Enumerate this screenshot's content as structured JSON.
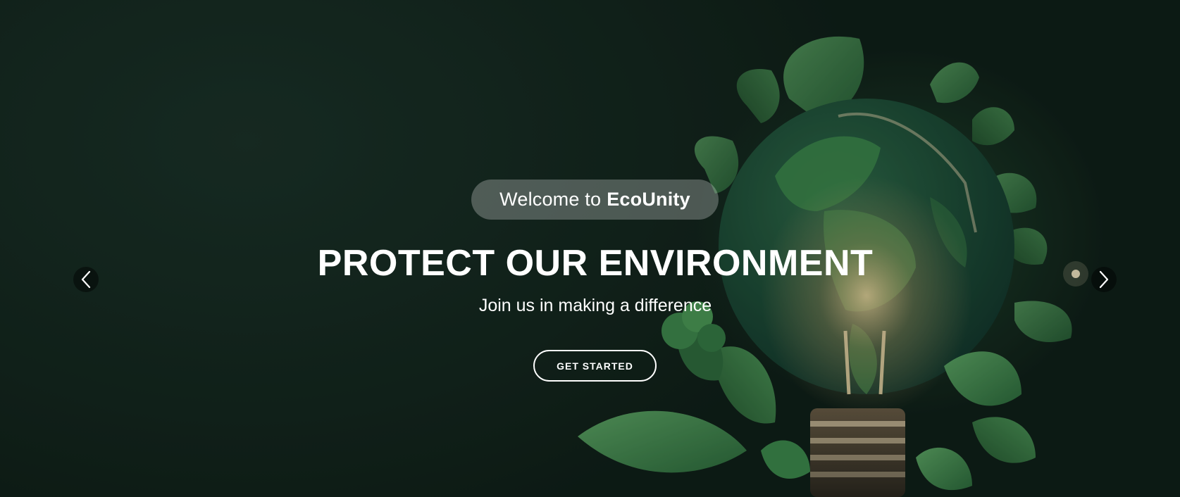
{
  "hero": {
    "welcome_prefix": "Welcome to",
    "brand_name": "EcoUnity",
    "headline": "PROTECT OUR ENVIRONMENT",
    "subheadline": "Join us in making a difference",
    "cta_label": "GET STARTED"
  },
  "icons": {
    "prev": "chevron-left-icon",
    "next": "chevron-right-icon",
    "background": "globe-lightbulb-leaves-image"
  },
  "colors": {
    "background": "#13241c",
    "leaf": "#3f8a4c",
    "text": "#ffffff",
    "pill": "rgba(255,255,255,0.26)"
  }
}
